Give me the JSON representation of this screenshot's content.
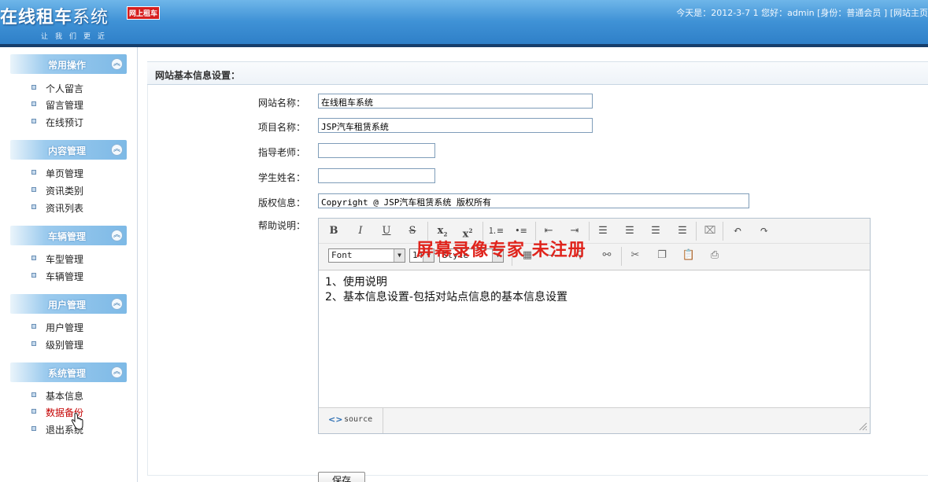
{
  "header": {
    "logo_bold": "在线租车",
    "logo_light": "系统",
    "slogan": "让我们更近",
    "badge": "网上租车",
    "today_label": "今天是：2012-3-7 1",
    "greeting": "您好：admin [身份：普通会员 ]",
    "site_link": "[网站主页"
  },
  "sidebar": {
    "sections": [
      {
        "title": "常用操作",
        "items": [
          "个人留言",
          "留言管理",
          "在线预订"
        ]
      },
      {
        "title": "内容管理",
        "items": [
          "单页管理",
          "资讯类别",
          "资讯列表"
        ]
      },
      {
        "title": "车辆管理",
        "items": [
          "车型管理",
          "车辆管理"
        ]
      },
      {
        "title": "用户管理",
        "items": [
          "用户管理",
          "级别管理"
        ]
      },
      {
        "title": "系统管理",
        "items": [
          "基本信息",
          "数据备份",
          "退出系统"
        ]
      }
    ],
    "toggle_glyph": "︽",
    "active_item": "数据备份"
  },
  "main": {
    "panel_title": "网站基本信息设置：",
    "fields": [
      {
        "label": "网站名称：",
        "value": "在线租车系统"
      },
      {
        "label": "项目名称：",
        "value": "JSP汽车租赁系统"
      },
      {
        "label": "指导老师：",
        "value": ""
      },
      {
        "label": "学生姓名：",
        "value": ""
      },
      {
        "label": "版权信息：",
        "value": "Copyright @ JSP汽车租赁系统 版权所有"
      }
    ],
    "help_label": "帮助说明：",
    "editor": {
      "font_select": "Font",
      "size_select": "14",
      "style_select": "Style",
      "watermark": "屏幕录像专家 未注册",
      "content_lines": [
        "1、使用说明",
        "2、基本信息设置-包括对站点信息的基本信息设置"
      ],
      "source_label": "source",
      "source_icon": "<>"
    },
    "save_label": "保存"
  },
  "colors": {
    "header_blue": "#3f92d6",
    "sidebar_head": "#7db9e6",
    "active_link": "#c40000",
    "watermark_red": "#e0241c"
  }
}
